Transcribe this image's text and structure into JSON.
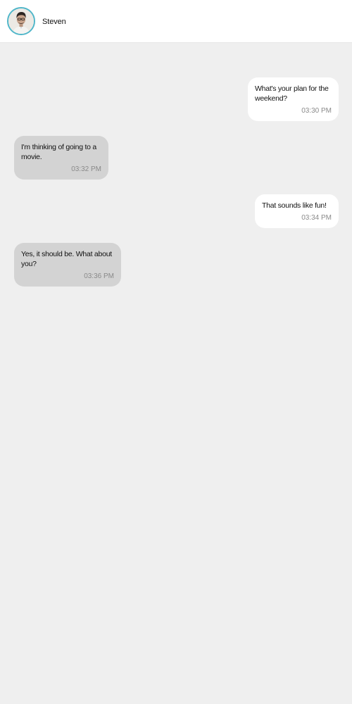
{
  "header": {
    "contact_name": "Steven",
    "avatar_icon": "person-avatar-icon",
    "avatar_border_color": "#4fb6c9"
  },
  "messages": [
    {
      "direction": "outgoing",
      "text": "What's your plan for the weekend?",
      "time": "03:30 PM"
    },
    {
      "direction": "incoming",
      "text": "I'm thinking of going to a movie.",
      "time": "03:32 PM"
    },
    {
      "direction": "outgoing",
      "text": "That sounds like fun!",
      "time": "03:34 PM"
    },
    {
      "direction": "incoming",
      "text": "Yes, it should be. What about you?",
      "time": "03:36 PM"
    }
  ],
  "colors": {
    "background": "#efefef",
    "header_background": "#ffffff",
    "outgoing_bubble": "#ffffff",
    "incoming_bubble": "#d3d3d3",
    "timestamp": "#8a8a8a"
  }
}
